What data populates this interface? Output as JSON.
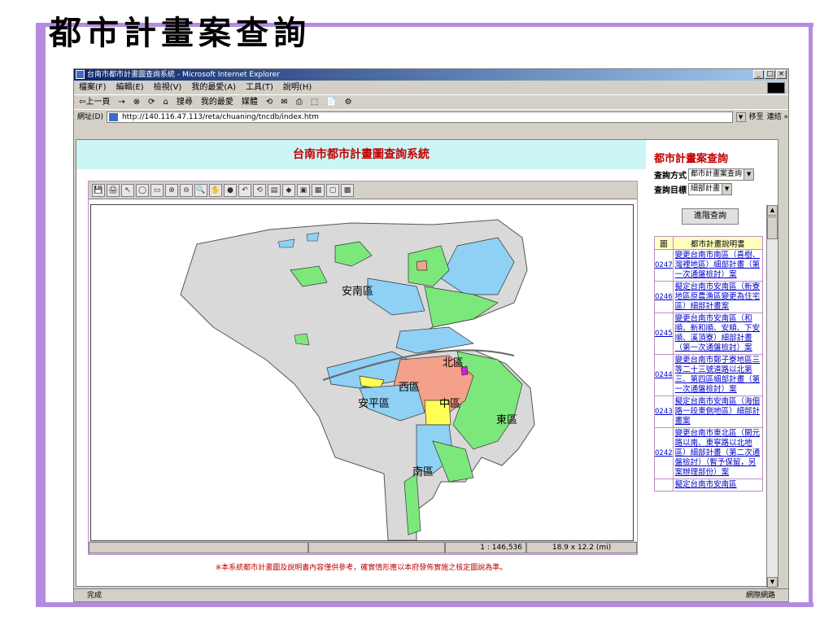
{
  "slide": {
    "title": "都市計畫案查詢"
  },
  "browser": {
    "window_title": "台南市都市計畫圖查詢系統 - Microsoft Internet Explorer",
    "title_buttons": [
      "_",
      "□",
      "×"
    ],
    "menu": [
      "檔案(F)",
      "編輯(E)",
      "檢視(V)",
      "我的最愛(A)",
      "工具(T)",
      "說明(H)"
    ],
    "toolbar": [
      "⇦上一頁",
      "→",
      "⊗",
      "⟳",
      "⌂",
      "搜尋",
      "我的最愛",
      "媒體",
      "⟲",
      "✉",
      "⎙",
      "⬚",
      "📄",
      "⚙"
    ],
    "address_label": "網址(D)",
    "address_value": "http://140.116.47.113/reta/chuaning/tncdb/index.htm",
    "go_label": "移至",
    "links_label": "連結 »",
    "status_left": "完成",
    "status_right": "網際網路"
  },
  "page": {
    "header": "台南市都市計畫圖查詢系統",
    "map_tools": [
      "💾",
      "🖨",
      "↖",
      "◯",
      "▭",
      "⊕",
      "⊖",
      "🔍",
      "✋",
      "●",
      "↶",
      "⟲",
      "▤",
      "◆",
      "▣",
      "▦",
      "▢",
      "▩"
    ],
    "scale": "1 : 146,536",
    "extent": "18.9 x 12.2 (mi)",
    "districts": [
      "安南區",
      "北區",
      "西區",
      "安平區",
      "中區",
      "東區",
      "南區"
    ],
    "disclaimer": "※本系統都市計畫圖及說明書內容僅供參考，確實情形應以本府發佈實施之核定圖說為準。"
  },
  "query": {
    "title": "都市計畫案查詢",
    "method_label": "查詢方式",
    "method_value": "都市計畫案查詢",
    "target_label": "查詢目標",
    "target_value": "細部計畫",
    "advanced_button": "進階查詢",
    "table_header_num": "圖",
    "table_header_title": "都市計畫說明書",
    "rows": [
      {
        "num": "0247",
        "title": "變更台南市南區（喜樹、灣裡地區）細部計畫（第一次通盤檢討）案"
      },
      {
        "num": "0246",
        "title": "擬定台南市安南區（新寮地區原農漁區變更為住宅區）細部計畫案"
      },
      {
        "num": "0245",
        "title": "變更台南市安南區（和順、新和順、安順、下安順、溪頂寮）細部計畫（第一次通盤檢討）案"
      },
      {
        "num": "0244",
        "title": "變更台南市鄭子寮地區三等二十三號道路以北第三、第四區細部計畫（第一次通盤檢討）案"
      },
      {
        "num": "0243",
        "title": "擬定台南市安南區（海佃路一段東側地區）細部計畫案"
      },
      {
        "num": "0242",
        "title": "變更台南市東北區（開元路以南、東寧路以北地區）細部計畫（第二次通盤檢討）（暫予保留，另案辦理部份）案"
      },
      {
        "num": "",
        "title": "擬定台南市安南區"
      }
    ]
  }
}
